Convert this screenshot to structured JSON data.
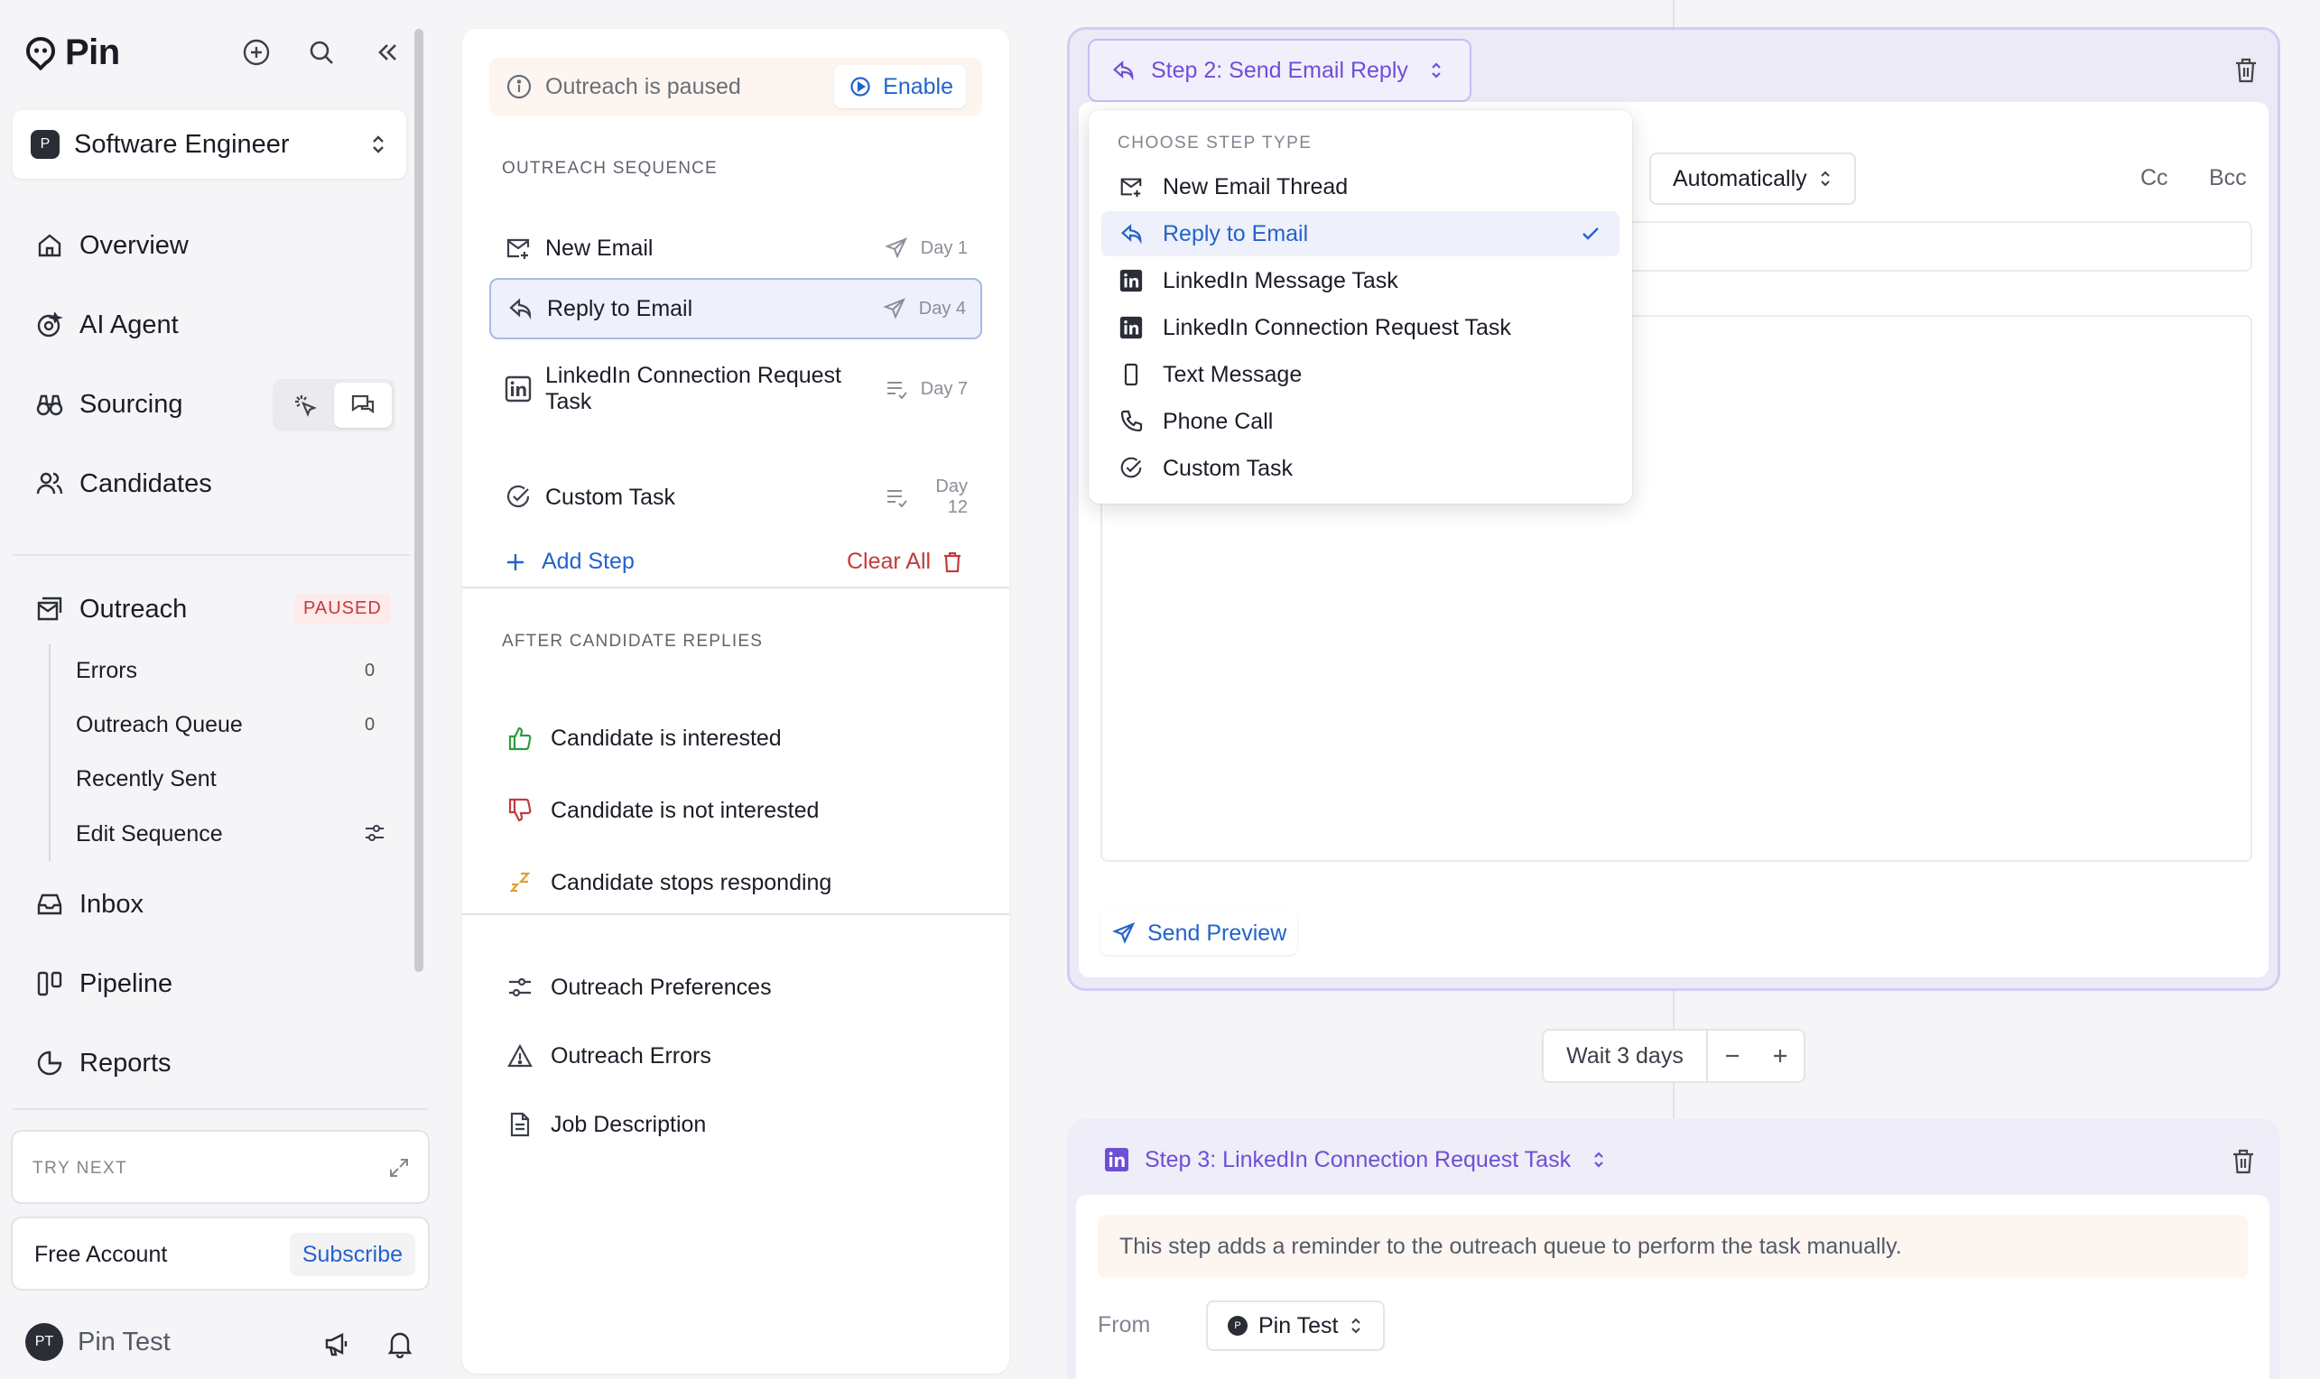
{
  "brand": {
    "name": "Pin"
  },
  "job": {
    "badge": "P",
    "title": "Software Engineer"
  },
  "nav": {
    "overview": "Overview",
    "ai_agent": "AI Agent",
    "sourcing": "Sourcing",
    "candidates": "Candidates",
    "outreach": "Outreach",
    "outreach_status": "PAUSED",
    "inbox": "Inbox",
    "pipeline": "Pipeline",
    "reports": "Reports"
  },
  "outreach_sub": {
    "errors": "Errors",
    "errors_count": "0",
    "queue": "Outreach Queue",
    "queue_count": "0",
    "recently_sent": "Recently Sent",
    "edit_sequence": "Edit Sequence"
  },
  "try_next": "TRY NEXT",
  "account": {
    "label": "Free Account",
    "subscribe": "Subscribe"
  },
  "user": {
    "initials": "PT",
    "name": "Pin Test"
  },
  "sequence": {
    "paused_text": "Outreach is paused",
    "enable_label": "Enable",
    "section_title": "OUTREACH SEQUENCE",
    "steps": [
      {
        "name": "New Email",
        "day": "Day 1"
      },
      {
        "name": "Reply to Email",
        "day": "Day 4"
      },
      {
        "name": "LinkedIn Connection Request Task",
        "day": "Day 7"
      },
      {
        "name": "Custom Task",
        "day": "Day 12"
      }
    ],
    "add_step": "Add Step",
    "clear_all": "Clear All",
    "after_title": "AFTER CANDIDATE REPLIES",
    "after": [
      "Candidate is interested",
      "Candidate is not interested",
      "Candidate stops responding"
    ],
    "prefs": [
      "Outreach Preferences",
      "Outreach Errors",
      "Job Description"
    ]
  },
  "editor": {
    "step2_title": "Step 2: Send Email Reply",
    "send_mode": "Automatically",
    "cc": "Cc",
    "bcc": "Bcc",
    "send_preview": "Send Preview",
    "wait_label": "Wait 3 days",
    "step3_title": "Step 3: LinkedIn Connection Request Task",
    "reminder": "This step adds a reminder to the outreach queue to perform the task manually.",
    "from_label": "From",
    "from_badge": "P",
    "from_value": "Pin Test"
  },
  "dropdown": {
    "title": "CHOOSE STEP TYPE",
    "items": [
      {
        "name": "New Email Thread",
        "icon": "email-icon"
      },
      {
        "name": "Reply to Email",
        "icon": "reply-icon",
        "selected": true
      },
      {
        "name": "LinkedIn Message Task",
        "icon": "linkedin-icon"
      },
      {
        "name": "LinkedIn Connection Request Task",
        "icon": "linkedin-icon"
      },
      {
        "name": "Text Message",
        "icon": "phone-device-icon"
      },
      {
        "name": "Phone Call",
        "icon": "phone-icon"
      },
      {
        "name": "Custom Task",
        "icon": "check-circle-icon"
      }
    ]
  },
  "colors": {
    "accent_blue": "#2463c9",
    "accent_purple": "#6d4fd6",
    "danger_red": "#c33b3b",
    "success_green": "#2f9a3f"
  }
}
